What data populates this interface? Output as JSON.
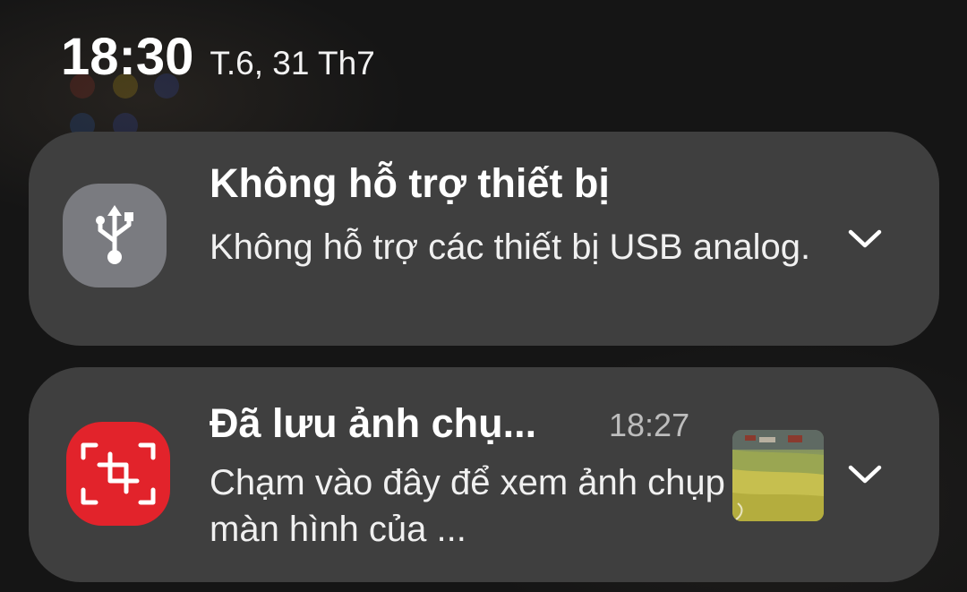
{
  "status_bar": {
    "time": "18:30",
    "date": "T.6, 31 Th7"
  },
  "notifications": [
    {
      "icon": "usb-icon",
      "title": "Không hỗ trợ thiết bị",
      "body": "Không hỗ trợ các thiết bị USB analog."
    },
    {
      "icon": "screenshot-icon",
      "title": "Đã lưu ảnh chụ...",
      "timestamp": "18:27",
      "body": "Chạm vào đây để xem ảnh chụp màn hình của ...",
      "thumbnail": "screenshot-thumbnail"
    }
  ],
  "colors": {
    "card_background": "#3f3f3f",
    "usb_icon_background": "#7a7b80",
    "screenshot_icon_background": "#e2232b"
  }
}
